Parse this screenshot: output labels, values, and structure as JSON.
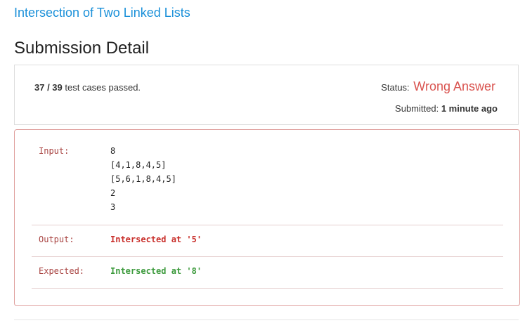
{
  "problem": {
    "title": "Intersection of Two Linked Lists"
  },
  "page": {
    "heading": "Submission Detail"
  },
  "summary": {
    "passed": "37 / 39",
    "passed_suffix": " test cases passed.",
    "status_label": "Status: ",
    "status_value": "Wrong Answer",
    "submitted_label": "Submitted: ",
    "submitted_value": "1 minute ago"
  },
  "result": {
    "input_label": "Input:",
    "input_lines": [
      "8",
      "[4,1,8,4,5]",
      "[5,6,1,8,4,5]",
      "2",
      "3"
    ],
    "output_label": "Output:",
    "output_value": "Intersected at '5'",
    "expected_label": "Expected:",
    "expected_value": "Intersected at '8'"
  },
  "colors": {
    "link": "#1a90d9",
    "wrong": "#d9534f",
    "correct": "#3c9a3c",
    "label": "#a94442"
  }
}
